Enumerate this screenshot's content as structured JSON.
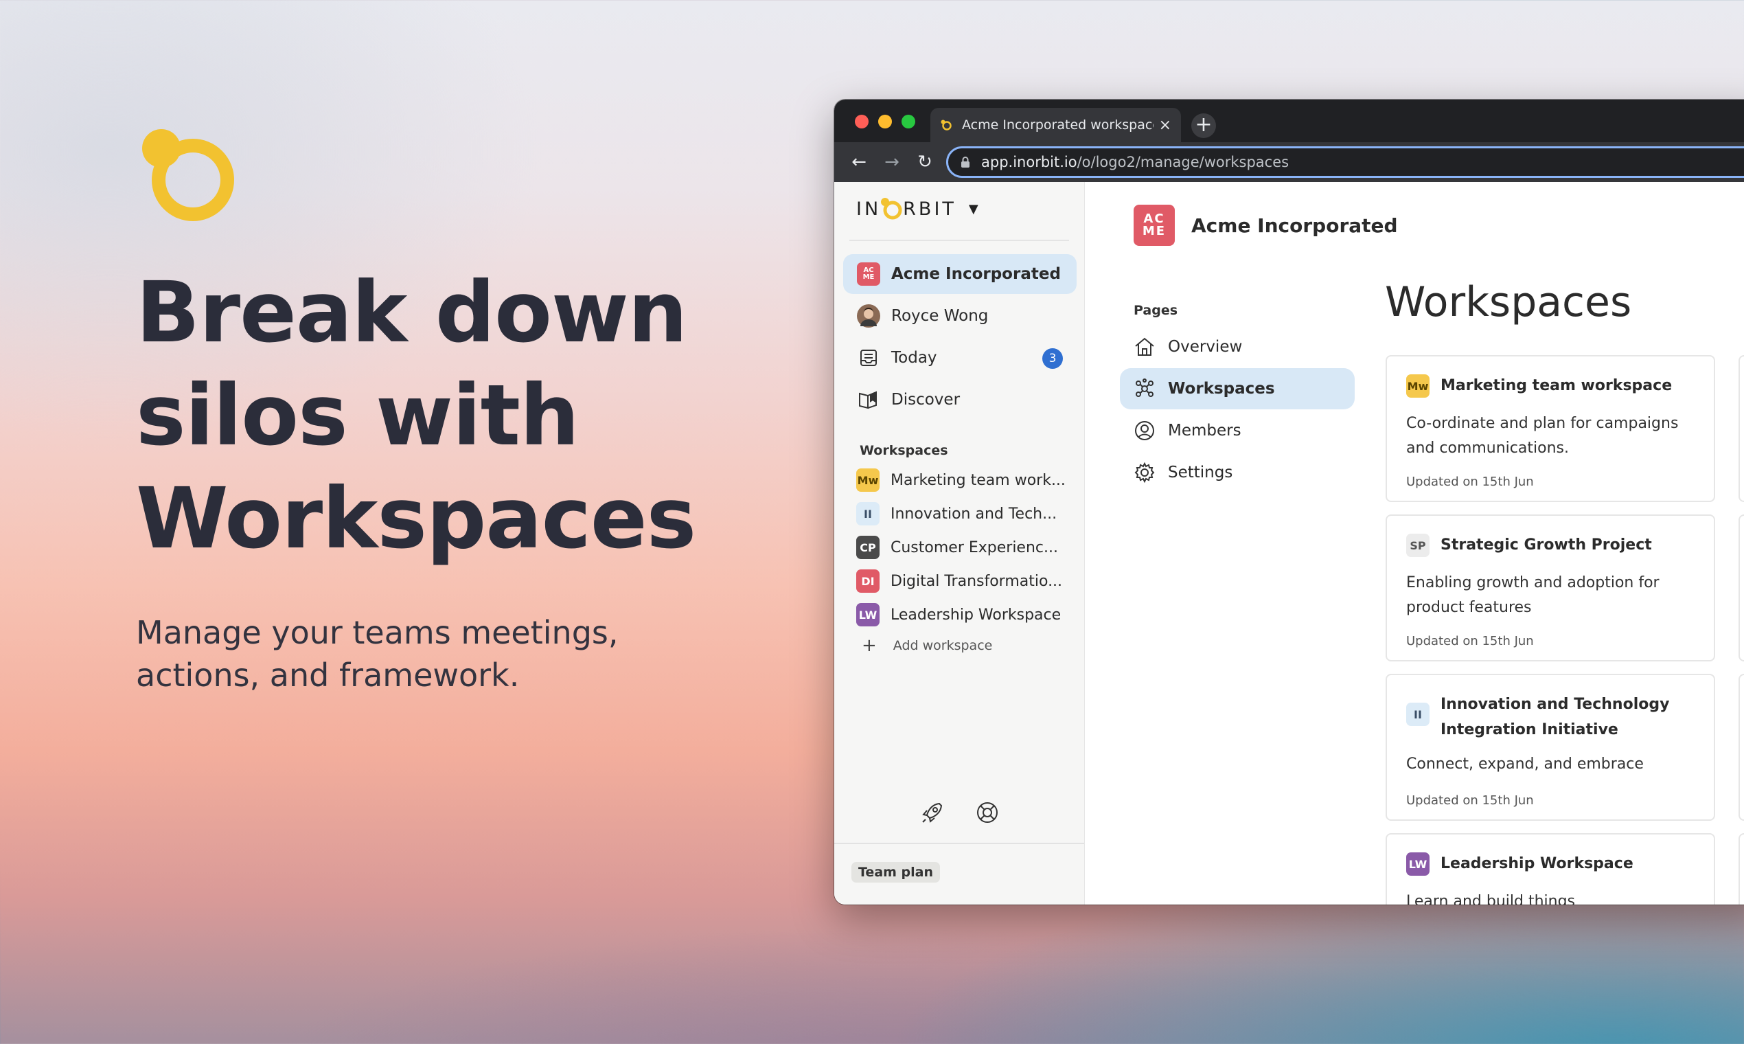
{
  "hero": {
    "title_lines": [
      "Break down",
      "silos with",
      "Workspaces"
    ],
    "subtitle_lines": [
      "Manage your teams meetings,",
      "actions, and framework."
    ],
    "logo_icon": "inorbit-logo-icon",
    "accent_color": "#f2c230"
  },
  "browser": {
    "tab_title": "Acme Incorporated workspace",
    "tab_close": "×",
    "new_tab": "+",
    "url_host": "app.inorbit.io",
    "url_path": "/o/logo2/manage/workspaces",
    "traffic_colors": [
      "#ff5f57",
      "#febc2e",
      "#28c840"
    ]
  },
  "sidebar": {
    "brand_left": "IN",
    "brand_right": "RBIT",
    "brand_caret": "▼",
    "items": [
      {
        "label": "Acme Incorporated",
        "icon": "acme-logo-icon"
      },
      {
        "label": "Royce Wong",
        "icon": "avatar"
      },
      {
        "label": "Today",
        "icon": "inbox-icon",
        "count": "3"
      },
      {
        "label": "Discover",
        "icon": "book-icon"
      }
    ],
    "workspaces_heading": "Workspaces",
    "workspaces": [
      {
        "badge": "Mw",
        "label": "Marketing team work...",
        "bg": "#f5c84c",
        "fg": "#5a4400"
      },
      {
        "badge": "II",
        "label": "Innovation and Tech...",
        "bg": "#dcebf7",
        "fg": "#3a4e66"
      },
      {
        "badge": "CP",
        "label": "Customer Experienc...",
        "bg": "#4a4a4a",
        "fg": "#ffffff"
      },
      {
        "badge": "DI",
        "label": "Digital Transformatio...",
        "bg": "#e05a66",
        "fg": "#ffffff"
      },
      {
        "badge": "LW",
        "label": "Leadership Workspace",
        "bg": "#8a5aa8",
        "fg": "#ffffff"
      }
    ],
    "add_workspace": "Add workspace",
    "plan": "Team plan"
  },
  "main": {
    "org_logo_top": "AC",
    "org_logo_bottom": "ME",
    "org_name": "Acme Incorporated",
    "pages_heading": "Pages",
    "pages": [
      {
        "label": "Overview",
        "icon": "home-icon"
      },
      {
        "label": "Workspaces",
        "icon": "workspaces-icon"
      },
      {
        "label": "Members",
        "icon": "user-circle-icon"
      },
      {
        "label": "Settings",
        "icon": "gear-icon"
      }
    ],
    "title": "Workspaces",
    "cards": [
      {
        "badge": "Mw",
        "title": "Marketing team workspace",
        "desc": "Co-ordinate and plan for campaigns and communications.",
        "updated": "Updated on 15th Jun",
        "bg": "#f5c84c",
        "fg": "#5a4400"
      },
      {
        "badge": "SP",
        "title": "Strategic Growth Project",
        "desc": "Enabling growth and adoption for product features",
        "updated": "Updated on 15th Jun",
        "bg": "#ececec",
        "fg": "#555555"
      },
      {
        "badge": "II",
        "title": "Innovation and Technology Integration Initiative",
        "desc": "Connect, expand, and embrace",
        "updated": "Updated on 15th Jun",
        "bg": "#dcebf7",
        "fg": "#3a4e66"
      },
      {
        "badge": "LW",
        "title": "Leadership Workspace",
        "desc": "Learn and build things",
        "updated": "",
        "bg": "#8a5aa8",
        "fg": "#ffffff"
      }
    ]
  }
}
